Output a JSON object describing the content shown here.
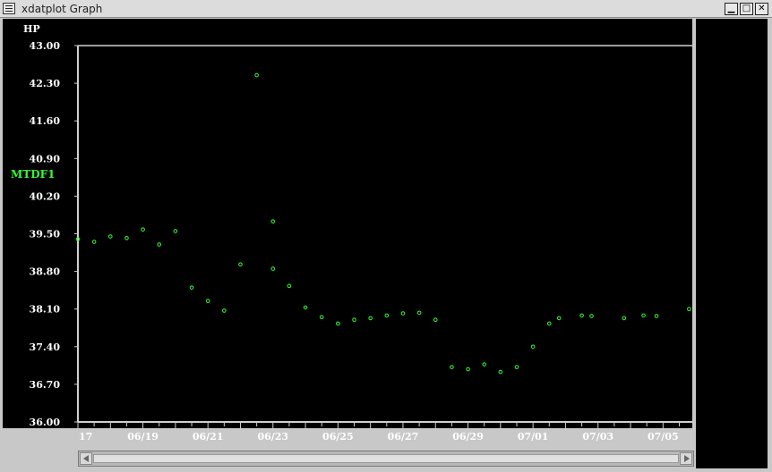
{
  "window": {
    "title": "xdatplot Graph",
    "minimize_glyph": "▁",
    "maximize_glyph": "□",
    "close_glyph": "✕"
  },
  "colors": {
    "plot_background": "#000000",
    "axis": "#d0d0d0",
    "marker": "#33ff33",
    "text": "#ffffff",
    "series_label": "#33ff33"
  },
  "chart_data": {
    "type": "scatter",
    "unit_label": "HP",
    "series_label": "MTDF1",
    "ylim": [
      36.0,
      43.0
    ],
    "y_ticks": [
      "43.00",
      "42.30",
      "41.60",
      "40.90",
      "40.20",
      "39.50",
      "38.80",
      "38.10",
      "37.40",
      "36.70",
      "36.00"
    ],
    "x_ticks": [
      "17",
      "06/19",
      "06/21",
      "06/23",
      "06/25",
      "06/27",
      "06/29",
      "07/01",
      "07/03",
      "07/05"
    ],
    "x_tick_days": [
      17,
      19,
      21,
      23,
      25,
      27,
      29,
      31,
      33,
      35
    ],
    "xlim_days": [
      17,
      35.9
    ],
    "grid": false,
    "marker": "open-circle",
    "series": [
      {
        "x_days": [
          17.0,
          17.5,
          18.0,
          18.5,
          19.0,
          19.5,
          20.0,
          20.5,
          21.0,
          21.5,
          22.0,
          22.5,
          23.0,
          23.0,
          23.5,
          24.0,
          24.5,
          25.0,
          25.5,
          26.0,
          26.5,
          27.0,
          27.5,
          28.0,
          28.5,
          29.0,
          29.5,
          30.0,
          30.5,
          31.0,
          31.5,
          31.8,
          32.5,
          32.8,
          33.8,
          34.4,
          34.8,
          35.8
        ],
        "y": [
          39.4,
          39.35,
          39.45,
          39.42,
          39.58,
          39.3,
          39.55,
          38.5,
          38.25,
          38.07,
          38.93,
          42.45,
          39.73,
          38.85,
          38.53,
          38.13,
          37.95,
          37.83,
          37.9,
          37.93,
          37.98,
          38.02,
          38.03,
          37.9,
          37.02,
          36.98,
          37.07,
          36.93,
          37.02,
          37.4,
          37.83,
          37.93,
          37.98,
          37.97,
          37.93,
          37.98,
          37.97,
          38.1
        ]
      }
    ]
  }
}
